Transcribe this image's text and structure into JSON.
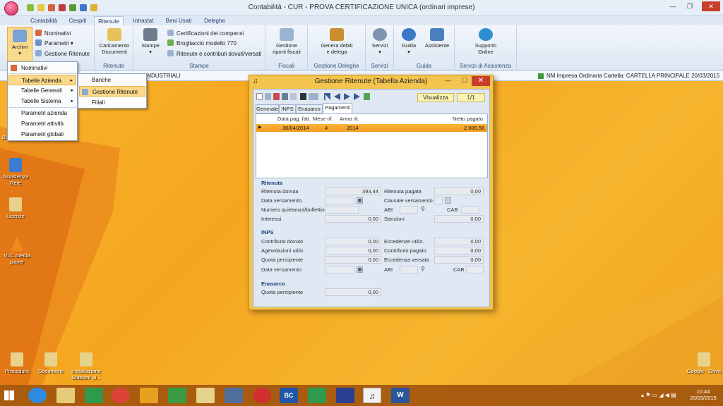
{
  "window": {
    "title": "Contabilità - CUR - PROVA CERTIFICAZIONE UNICA (ordinari imprese)",
    "minimize": "—",
    "restore": "❐",
    "close": "✕"
  },
  "tabs": [
    "Contabilità",
    "Cespiti",
    "Ritenute",
    "Intrastat",
    "Beni Usati",
    "Deleghe"
  ],
  "ribbon": {
    "archivi": {
      "label": "Archivi",
      "arrow": "▾",
      "items": [
        "Nominativi",
        "Parametri ▾",
        "Gestione Ritenute"
      ]
    },
    "ritenute_group": {
      "button": [
        "Caricamento",
        "Documenti"
      ],
      "label": "Ritenute"
    },
    "stampe_group": {
      "button": "Stampe",
      "arrow": "▾",
      "items": [
        "Certificazioni dei compensi",
        "Brogliaccio modello 770",
        "Ritenute e contributi dovuti/versati"
      ],
      "label": "Stampe"
    },
    "fiscali_group": {
      "button": [
        "Gestione",
        "riporti fiscali"
      ],
      "label": "Fiscali"
    },
    "deleghe_group": {
      "button": [
        "Genera debiti",
        "e delega"
      ],
      "label": "Gestione Deleghe"
    },
    "servizi_group": {
      "button": "Servizi",
      "arrow": "▾",
      "label": "Servizi"
    },
    "guida_group": {
      "buttons": [
        "Guida",
        "Assistente"
      ],
      "arrow": "▾",
      "label": "Guida"
    },
    "supporto_group": {
      "button": [
        "Supporto",
        "Online"
      ],
      "label": "Servizi di Assistenza"
    }
  },
  "statusbar": {
    "left": "INDUSTRIALI",
    "right": "NM  Impresa  Ordinaria  Cartella: CARTELLA PRINCIPALE  20/03/2015"
  },
  "menus": {
    "main": [
      "Nominativi",
      "Tabelle Azienda",
      "Tabelle Generali",
      "Tabelle Sistema",
      "Parametri azienda",
      "Parametri attività",
      "Parametri globali"
    ],
    "submenu_arrow": "▸",
    "sub": [
      "Banche",
      "Gestione Ritenute",
      "Filiali"
    ]
  },
  "desktop_icons": [
    "BurnLite 10",
    "Assistenza Rete",
    "Licenze",
    "VLC media player",
    "Procedure",
    "Documenti",
    "Installazione Stazioni_8...",
    "Google - Drive"
  ],
  "taskbar": {
    "time": "10.44",
    "date": "20/03/2015"
  },
  "dialog": {
    "title": "Gestione Ritenute (Tabella Azienda)",
    "visualizza": "Visualizza",
    "pager": "1/1",
    "tabs": [
      "Generale",
      "INPS",
      "Enasarco",
      "Pagamenti"
    ],
    "grid": {
      "headers": [
        "Data pag. fatt.",
        "Mese rif.",
        "Anno rit.",
        "Netto pagato"
      ],
      "row_marker": "▶",
      "rows": [
        {
          "data": "30/04/2014",
          "mese": "4",
          "anno": "2014",
          "netto": "2.006,56"
        }
      ]
    },
    "ritenuta": {
      "title": "Ritenuta",
      "dovuta_label": "Ritenuta dovuta",
      "dovuta": "393,44",
      "pagata_label": "Ritenuta pagata",
      "pagata": "0,00",
      "data_versamento_label": "Data versamento",
      "causale_label": "Causale versamento",
      "quietanza_label": "Numero quietanza/bollettino",
      "abi_label": "ABI",
      "cab_label": "CAB",
      "interessi_label": "Interessi",
      "interessi": "0,00",
      "sanzioni_label": "Sanzioni",
      "sanzioni": "0,00"
    },
    "inps": {
      "title": "INPS",
      "contributo_dovuto_label": "Contributo dovuto",
      "contributo_dovuto": "0,00",
      "eccedenze_utiliz_label": "Eccedenze utiliz.",
      "eccedenze_utiliz": "0,00",
      "agevolazioni_label": "Agevolazioni utiliz.",
      "agevolazioni": "0,00",
      "contributo_pagato_label": "Contributo pagato",
      "contributo_pagato": "0,00",
      "quota_percipiente_label": "Quota percipiente",
      "quota_percipiente": "0,00",
      "eccedenza_versata_label": "Eccedenza versata",
      "eccedenza_versata": "0,00",
      "data_versamento_label": "Data versamento",
      "abi_label": "ABI",
      "cab_label": "CAB"
    },
    "enasarco": {
      "title": "Enasarco",
      "quota_label": "Quota percipiente",
      "quota": "0,00"
    }
  }
}
